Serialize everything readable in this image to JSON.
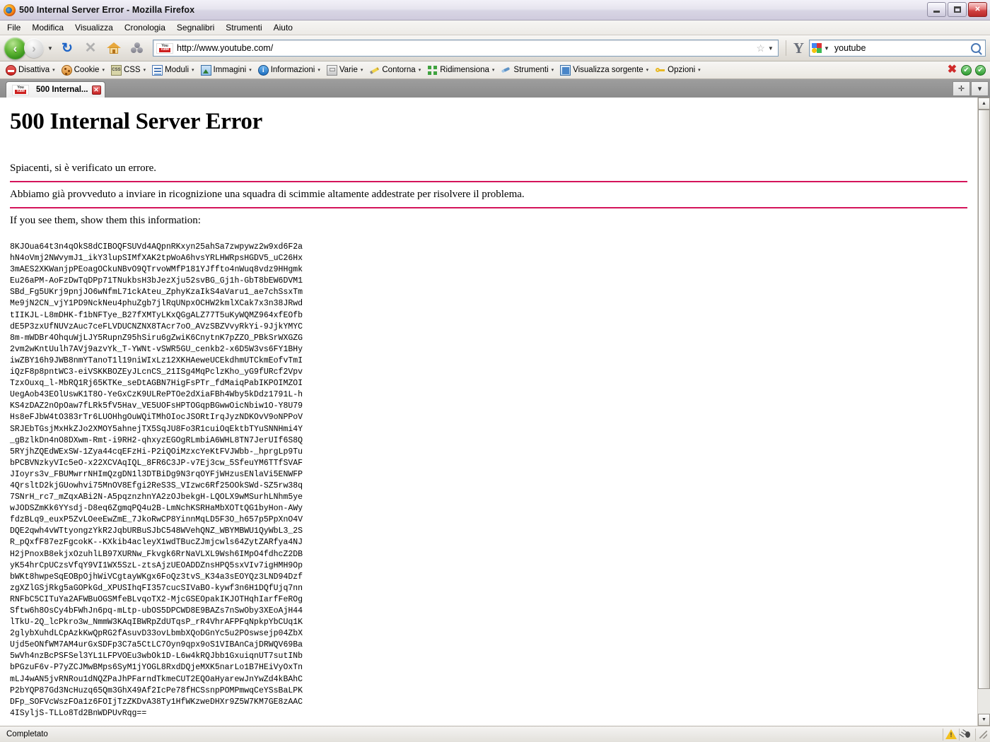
{
  "window": {
    "title": "500 Internal Server Error - Mozilla Firefox",
    "minimize_label": "",
    "maximize_label": "",
    "close_label": "✕"
  },
  "menubar": {
    "items": [
      {
        "label": "File"
      },
      {
        "label": "Modifica"
      },
      {
        "label": "Visualizza"
      },
      {
        "label": "Cronologia"
      },
      {
        "label": "Segnalibri"
      },
      {
        "label": "Strumenti"
      },
      {
        "label": "Aiuto"
      }
    ]
  },
  "navbar": {
    "back_icon": "back-arrow-icon",
    "forward_icon": "forward-arrow-icon",
    "history_caret": "▼",
    "reload_icon": "↻",
    "stop_icon": "✕",
    "home_icon": "home-icon",
    "feed_icon": "feed-icon",
    "url": "http://www.youtube.com/",
    "url_site_badge_top": "You",
    "url_site_badge_bottom": "Tube",
    "bookmark_star": "☆",
    "url_dropdown_caret": "▼",
    "yahoo_icon": "Y",
    "search_engine_icon": "google-icon",
    "search_engine_caret": "▼",
    "search_value": "youtube",
    "search_go_icon": "magnifier-icon"
  },
  "devbar": {
    "items": [
      {
        "label": "Disattiva",
        "icon": "disable-icon",
        "caret": "▾"
      },
      {
        "label": "Cookie",
        "icon": "cookie-icon",
        "caret": "▾"
      },
      {
        "label": "CSS",
        "icon": "css-icon",
        "caret": "▾"
      },
      {
        "label": "Moduli",
        "icon": "forms-icon",
        "caret": "▾"
      },
      {
        "label": "Immagini",
        "icon": "images-icon",
        "caret": "▾"
      },
      {
        "label": "Informazioni",
        "icon": "information-icon",
        "caret": "▾"
      },
      {
        "label": "Varie",
        "icon": "miscellaneous-icon",
        "caret": "▾"
      },
      {
        "label": "Contorna",
        "icon": "outline-icon",
        "caret": "▾"
      },
      {
        "label": "Ridimensiona",
        "icon": "resize-icon",
        "caret": "▾"
      },
      {
        "label": "Strumenti",
        "icon": "tools-icon",
        "caret": "▾"
      },
      {
        "label": "Visualizza sorgente",
        "icon": "view-source-icon",
        "caret": "▾"
      },
      {
        "label": "Opzioni",
        "icon": "options-icon",
        "caret": "▾"
      }
    ],
    "status_icons": [
      {
        "name": "validation-error-icon",
        "glyph": "✖"
      },
      {
        "name": "validation-ok-icon",
        "glyph": "✔"
      },
      {
        "name": "validation-ok2-icon",
        "glyph": "✔"
      }
    ]
  },
  "tabs": {
    "items": [
      {
        "label": "500 Internal...",
        "favicon": "youtube-favicon",
        "close_glyph": "✕"
      }
    ],
    "new_tab_glyph": "✛",
    "tab_list_glyph": "▾"
  },
  "page": {
    "heading": "500 Internal Server Error",
    "paragraph1": "Spiacenti, si è verificato un errore.",
    "paragraph2": "Abbiamo già provveduto a inviare in ricognizione una squadra di scimmie altamente addestrate per risolvere il problema.",
    "paragraph3": "If you see them, show them this information:",
    "rule_color": "#d4145a",
    "dump": "8KJOua64t3n4qOkS8dCIBOQFSUVd4AQpnRKxyn25ahSa7zwpywz2w9xd6F2a\nhN4oVmj2NWvymJ1_ikY3lupSIMfXAK2tpWoA6hvsYRLHWRpsHGDV5_uC26Hx\n3mAES2XKWanjpPEoagOCkuNBvO9QTrvoWMfP181YJffto4nWuq8vdz9HHgmk\nEu26aPM-AoFzDwTqDPp71TNukbsH3bJezXju52svBG_Gj1h-GbT8bEW6DVM1\nSBd_Fg5UKrj9pnjJO6wNfmL71ckAteu_ZphyKzaIkS4aVaru1_ae7chSsxTm\nMe9jN2CN_vjY1PD9NckNeu4phuZgb7jlRqUNpxOCHW2kmlXCak7x3n38JRwd\ntIIKJL-L8mDHK-f1bNFTye_B27fXMTyLKxQGgALZ77T5uKyWQMZ964xfEOfb\ndE5P3zxUfNUVzAuc7ceFLVDUCNZNX8TAcr7oO_AVzSBZVvyRkYi-9JjkYMYC\n8m-mWDBr4OhquWjLJY5RupnZ95hSiru6gZwiK6CnytnK7pZZO_PBkSrWXGZG\n2vm2wKntUulh7AVj9azvYk_T-YWNt-vSWR5GU_cenkb2-x6D5W3vs6FY1BHy\niwZBY16h9JWB8nmYTanoT1l19niWIxLz12XKHAeweUCEkdhmUTCkmEofvTmI\niQzF8p8pntWC3-eiVSKKBOZEyJLcnCS_21ISg4MqPclzKho_yG9fURcf2Vpv\nTzxOuxq_l-MbRQ1Rj65KTKe_seDtAGBN7HigFsPTr_fdMaiqPabIKPOIMZOI\nUegAob43EOlUswK1T8O-YeGxCzK9ULRePTOe2dXiaFBh4Wby5kDdz1791L-h\nKS4zDAZ2nOpOaw7fLRk5fV5Hav_VE5UOFsHPTOGqpBGwwOicNbiw1O-Y8U79\nHs8eFJbW4tO383rTr6LUOHhgOuWQiTMhOIocJSORtIrqJyzNDKOvV9oNPPoV\nSRJEbTGsjMxHkZJo2XMOY5ahnejTX5SqJU8Fo3R1cuiOqEktbTYuSNNHmi4Y\n_gBzlkDn4nO8DXwm-Rmt-i9RH2-qhxyzEGOgRLmbiA6WHL8TN7JerUIf6S8Q\n5RYjhZQEdWExSW-1Zya44cqEFzHi-P2iQOiMzxcYeKtFVJWbb-_hprgLp9Tu\nbPCBVNzkyVIc5eO-x22XCVAqIQL_8FR6C3JP-v7Ej3cw_5SfeuYM6TTfSVAF\nJIoyrs3v_FBUMwrrNHImQzgDN1l3DTBiDg9N3rqOYFjWHzusENlaVi5ENWFP\n4QrsltD2kjGUowhvi75MnOV8Efgi2ReS3S_VIzwc6Rf25OOkSWd-SZ5rw38q\n7SNrH_rc7_mZqxABi2N-A5pqznzhnYA2zOJbekgH-LQOLX9wMSurhLNhm5ye\nwJODSZmKk6YYsdj-D8eq6ZgmqPQ4u2B-LmNchKSRHaMbXOTtQG1byHon-AWy\nfdzBLq9_euxP5ZvLOeeEwZmE_7JkoRwCP8YinnMqLD5F3O_h657p5PpXnO4V\nDQE2qwh4vWTtyongzYkR2JqbURBuSJbC548WVehQNZ_WBYMBWU1QyWbL3_2S\nR_pQxfF87ezFgcokK--KXkib4acleyX1wdTBucZJmjcwls64ZytZARfya4NJ\nH2jPnoxB8ekjxOzuhlLB97XURNw_Fkvgk6RrNaVLXL9Wsh6IMpO4fdhcZ2DB\nyK54hrCpUCzsVfqY9VI1WX5SzL-ztsAjzUEOADDZnsHPQ5sxVIv7igHMH9Op\nbWKt8hwpeSqEOBpOjhWiVCgtayWKgx6FoQz3tvS_K34a3sEOYQz3LND94Dzf\nzgXZlGSjRkg5aGOPkGd_XPUSIhqFI357cucSIVaBO-kywf3n6H1DQfUjq7nn\nRNFbC5CITuYa2AFWBuOGSMfeBLvqoTX2-MjcGSEOpakIKJOTHqhIarfFeROg\nSftw6h8OsCy4bFWhJn6pq-mLtp-ubOS5DPCWD8E9BAZs7nSwOby3XEoAjH44\nlTkU-2Q_lcPkro3w_NmmW3KAqIBWRpZdUTqsP_rR4VhrAFPFqNpkpYbCUq1K\n2glybXuhdLCpAzkKwQpRG2fAsuvD33ovLbmbXQoDGnYc5u2POswsejp04ZbX\nUjd5eONfWM7AM4urGxSDFp3C7a5CtLC7Oyn9qpx9oS1VIBAnCajDRWQV69Ba\n5wVh4nzBcPSFSel3YL1LFPVOEu3wbOk1D-L6w4kRQJbb1GxuiqnUT7sutINb\nbPGzuF6v-P7yZCJMwBMps6SyM1jYOGL8RxdDQjeMXK5narLo1B7HEiVyOxTn\nmLJ4wAN5jvRNRou1dNQZPaJhPFarndTkmeCUT2EQOaHyarewJnYwZd4kBAhC\nP2bYQP87Gd3NcHuzq65Qm3GhX49Af2IcPe78fHCSsnpPOMPmwqCeYSsBaLPK\nDFp_SOFVcWszFOa1z6FOIjTzZKDvA38Ty1HfWKzweDHXr9Z5W7KM7GE8zAAC\n4ISyljS-TLLo8Td2BnWDPUvRqg=="
  },
  "statusbar": {
    "text": "Completato",
    "icons": [
      {
        "name": "warning-icon"
      },
      {
        "name": "firebug-icon"
      },
      {
        "name": "resize-grip-icon"
      }
    ]
  }
}
